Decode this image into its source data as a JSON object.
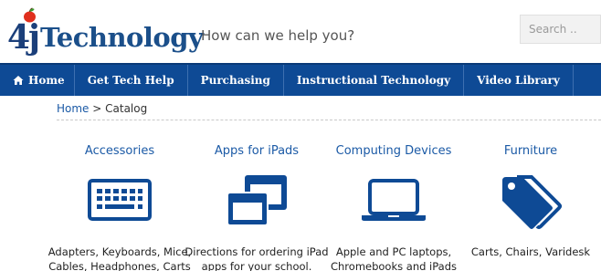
{
  "header": {
    "logo_prefix": "4j",
    "logo_word": "Technology",
    "tagline": "How can we help you?",
    "search_placeholder": "Search ..",
    "brand_color": "#1b4f8a"
  },
  "nav": {
    "color": "#0e4a95",
    "items": [
      {
        "label": "Home",
        "icon": "home-icon"
      },
      {
        "label": "Get Tech Help"
      },
      {
        "label": "Purchasing"
      },
      {
        "label": "Instructional Technology"
      },
      {
        "label": "Video Library"
      }
    ]
  },
  "breadcrumb": {
    "home": "Home",
    "separator": " > ",
    "current": "Catalog"
  },
  "catalog": [
    {
      "title": "Accessories",
      "icon": "keyboard-icon",
      "desc": "Adapters, Keyboards, Mice, Cables, Headphones, Carts"
    },
    {
      "title": "Apps for iPads",
      "icon": "windows-icon",
      "desc": "Directions for ordering iPad apps for your school."
    },
    {
      "title": "Computing Devices",
      "icon": "laptop-icon",
      "desc": "Apple and PC laptops, Chromebooks and iPads"
    },
    {
      "title": "Furniture",
      "icon": "tags-icon",
      "desc": "Carts, Chairs, Varidesk"
    }
  ]
}
